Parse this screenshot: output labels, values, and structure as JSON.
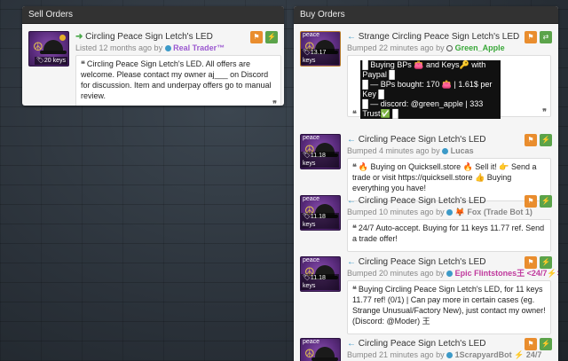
{
  "sell_panel": {
    "title": "Sell Orders",
    "listings": [
      {
        "name": "Circling Peace Sign Letch's LED",
        "price": "20 keys",
        "meta": "Listed 12 months ago by",
        "user": "Real Trader™",
        "user_color": "#9b59d0",
        "comment": "Circling Peace Sign Letch's LED. All offers are welcome. Please contact my owner aj___ on Discord for discussion. Item and underpay offers go to manual review."
      }
    ]
  },
  "buy_panel": {
    "title": "Buy Orders",
    "listings": [
      {
        "name": "Strange Circling Peace Sign Letch's LED",
        "price": "13.17 keys",
        "meta": "Bumped 22 minutes ago by",
        "user": "Green_Apple",
        "user_color": "#3aa83a",
        "comment_lines": [
          "█ Buying BPs 👛 and Keys🔑 with Paypal █",
          "█ — BPs bought: 170 👛 | 1.61$ per Key █",
          "█ — discord: @green_apple | 333 Trust✅ █"
        ]
      },
      {
        "name": "Circling Peace Sign Letch's LED",
        "price": "11.18 keys",
        "meta": "Bumped 4 minutes ago by",
        "user": "Lucas",
        "user_color": "#222222",
        "comment": "🔥 Buying on Quicksell.store 🔥 Sell it! 👉 Send a trade or visit https://quicksell.store 👍 Buying everything you have!"
      },
      {
        "name": "Circling Peace Sign Letch's LED",
        "price": "11.18 keys",
        "meta": "Bumped 10 minutes ago by",
        "user": "🦊 Fox (Trade Bot 1)",
        "user_color": "#222222",
        "comment": "24/7 Auto-accept. Buying for 11 keys 11.77 ref. Send a trade offer!"
      },
      {
        "name": "Circling Peace Sign Letch's LED",
        "price": "11.18 keys",
        "meta": "Bumped 20 minutes ago by",
        "user": "Epic Flintstones王 <24/7⚡> ⚡",
        "user_color": "#c0399d",
        "comment": "Buying Circling Peace Sign Letch's LED, for 11 keys 11.77 ref! (0/1) | Can pay more in certain cases (eg. Strange Unusual/Factory New), just contact my owner! (Discord: @Moder) 王"
      },
      {
        "name": "Circling Peace Sign Letch's LED",
        "price": "",
        "meta": "Bumped 21 minutes ago by",
        "user": "1ScrapyardBot ⚡ 24/7",
        "user_color": "#222222",
        "comment": ""
      }
    ]
  },
  "icons": {
    "arrow_buy": "←",
    "arrow_sell": "➜",
    "peace_label": "peace",
    "peace_symbol": "☮",
    "tag": "🏷",
    "flag": "⚑",
    "lightning": "⚡",
    "swap": "⇄",
    "quote_open": "❝",
    "quote_close": "❞"
  },
  "colors": {
    "orange_button": "#e98d2e",
    "green_button": "#5ba34a",
    "header": "#323232"
  }
}
